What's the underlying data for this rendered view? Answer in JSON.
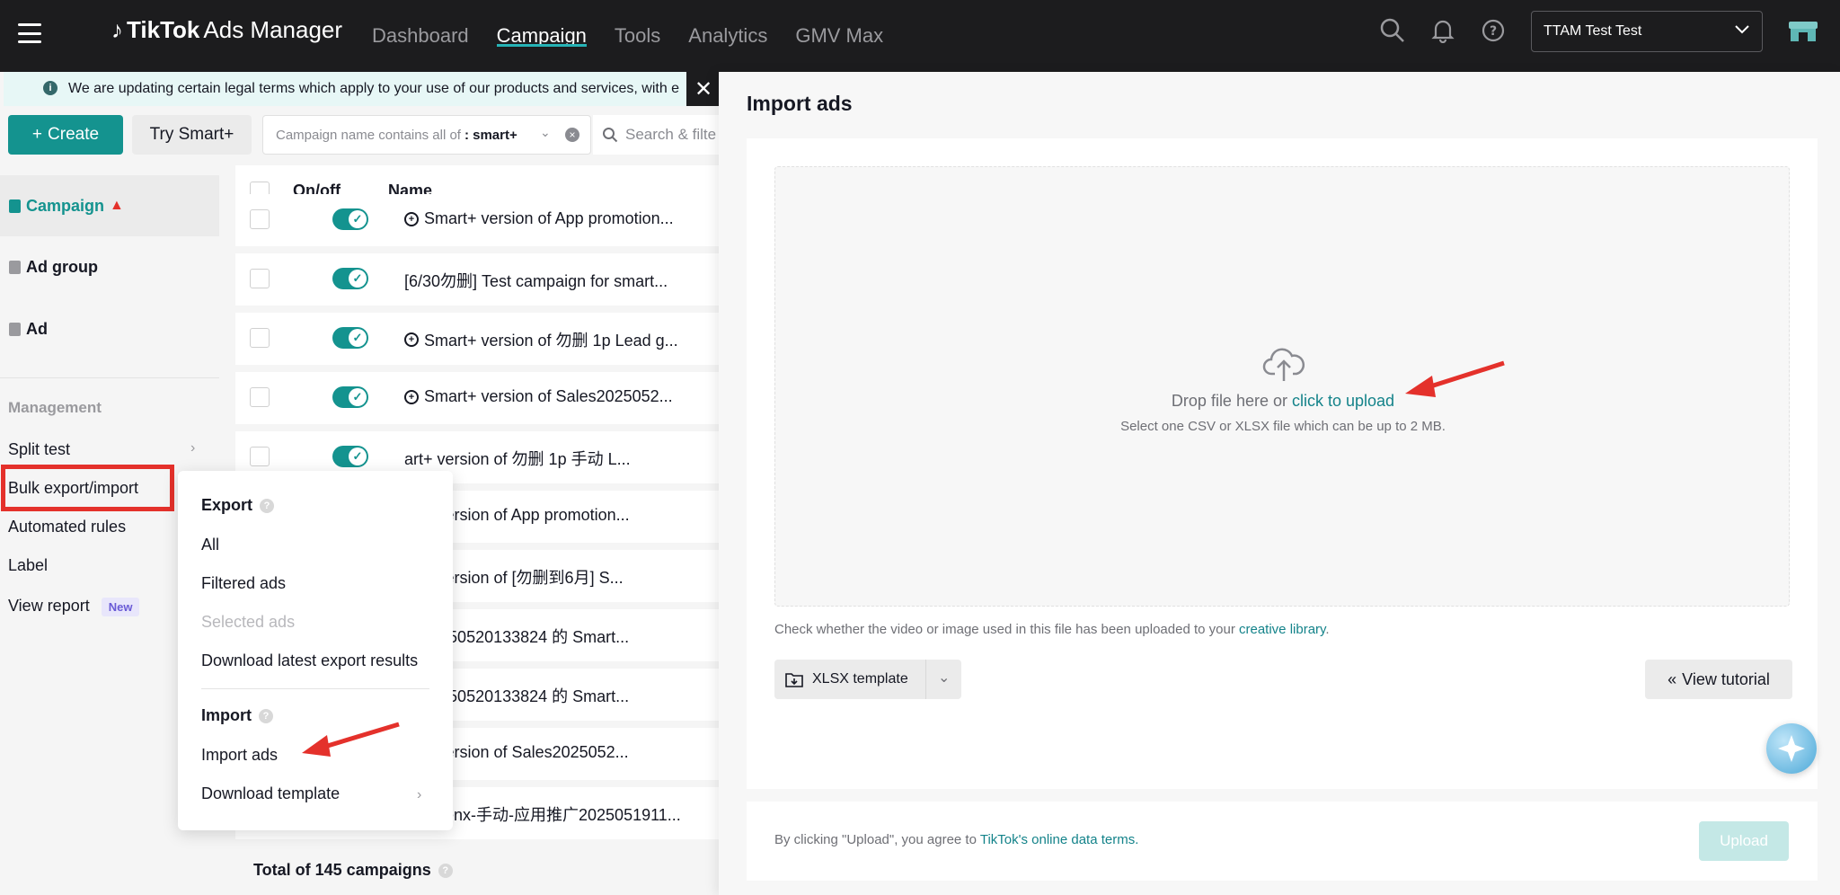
{
  "header": {
    "logo_brand": "TikTok",
    "logo_product": "Ads Manager",
    "nav": [
      "Dashboard",
      "Campaign",
      "Tools",
      "Analytics",
      "GMV Max"
    ],
    "active_nav": "Campaign",
    "account": "TTAM Test Test"
  },
  "notice": {
    "text": "We are updating certain legal terms which apply to your use of our products and services, with e"
  },
  "toolbar": {
    "create_label": "Create",
    "try_smart_label": "Try Smart+",
    "filter_chip_prefix": "Campaign name contains all of",
    "filter_chip_value": ": smart+",
    "search_placeholder": "Search & filte"
  },
  "sidenav": {
    "items": [
      {
        "label": "Campaign"
      },
      {
        "label": "Ad group"
      },
      {
        "label": "Ad"
      }
    ],
    "management_label": "Management",
    "management_items": [
      {
        "label": "Split test"
      },
      {
        "label": "Bulk export/import"
      },
      {
        "label": "Automated rules"
      },
      {
        "label": "Label"
      },
      {
        "label": "View report",
        "badge": "New"
      }
    ]
  },
  "table": {
    "headers": {
      "onoff": "On/off",
      "name": "Name"
    },
    "rows": [
      {
        "name": "Smart+ version of App promotion...",
        "smart": true
      },
      {
        "name": "[6/30勿删] Test campaign for smart...",
        "smart": false
      },
      {
        "name": "Smart+ version of 勿删 1p Lead g...",
        "smart": true
      },
      {
        "name": "Smart+ version of Sales2025052...",
        "smart": true
      },
      {
        "name": "art+ version of 勿删 1p 手动 L...",
        "smart": false
      },
      {
        "name": "art+ version of App promotion...",
        "smart": false
      },
      {
        "name": "art+ version of [勿删到6月] S...",
        "smart": false
      },
      {
        "name": "es20250520133824 的 Smart...",
        "smart": false
      },
      {
        "name": "es20250520133824 的 Smart...",
        "smart": false
      },
      {
        "name": "art+ version of Sales2025052...",
        "smart": false
      },
      {
        "name": "levenx-手动-应用推广2025051911...",
        "smart": true
      }
    ],
    "total": "Total of 145 campaigns"
  },
  "menu": {
    "export_label": "Export",
    "export_items": [
      "All",
      "Filtered ads",
      "Selected ads",
      "Download latest export results"
    ],
    "import_label": "Import",
    "import_items": [
      "Import ads",
      "Download template"
    ]
  },
  "drawer": {
    "title": "Import ads",
    "drop_text": "Drop file here or",
    "upload_link": "click to upload",
    "drop_sub": "Select one CSV or XLSX file which can be up to 2 MB.",
    "check_text": "Check whether the video or image used in this file has been uploaded to your",
    "creative_link": "creative library",
    "template_label": "XLSX template",
    "tutorial_label": "View tutorial",
    "terms_text": "By clicking \"Upload\", you agree to",
    "terms_link": "TikTok's online data terms.",
    "upload_label": "Upload"
  },
  "colors": {
    "accent": "#14938f",
    "nav_bg": "#1c1c1e",
    "highlight": "#e4312b"
  }
}
